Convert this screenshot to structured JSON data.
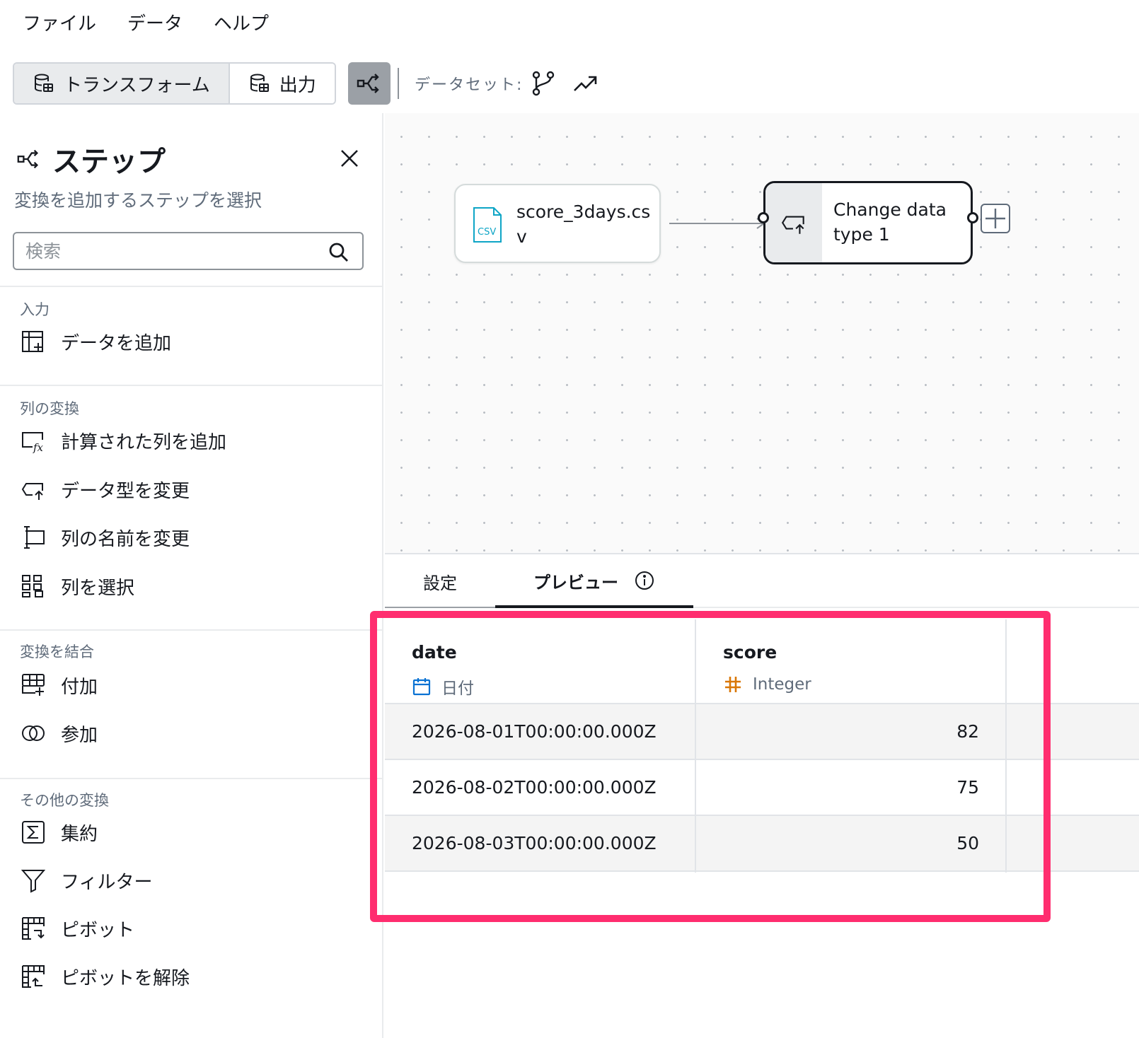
{
  "menu": {
    "file": "ファイル",
    "data": "データ",
    "help": "ヘルプ"
  },
  "toolbar": {
    "transform_label": "トランスフォーム",
    "output_label": "出力",
    "dataset_label": "データセット:",
    "icons": [
      "database-icon",
      "graph-icon",
      "branch-icon",
      "trend-icon"
    ]
  },
  "steps_panel": {
    "title": "ステップ",
    "subtitle": "変換を追加するステップを選択",
    "search_placeholder": "検索",
    "sections": [
      {
        "title": "入力",
        "items": [
          {
            "label": "データを追加",
            "icon": "add-data-icon"
          }
        ]
      },
      {
        "title": "列の変換",
        "items": [
          {
            "label": "計算された列を追加",
            "icon": "calculated-column-icon"
          },
          {
            "label": "データ型を変更",
            "icon": "change-type-icon"
          },
          {
            "label": "列の名前を変更",
            "icon": "rename-column-icon"
          },
          {
            "label": "列を選択",
            "icon": "select-columns-icon"
          }
        ]
      },
      {
        "title": "変換を結合",
        "items": [
          {
            "label": "付加",
            "icon": "append-icon"
          },
          {
            "label": "参加",
            "icon": "join-icon"
          }
        ]
      },
      {
        "title": "その他の変換",
        "items": [
          {
            "label": "集約",
            "icon": "aggregate-icon"
          },
          {
            "label": "フィルター",
            "icon": "filter-icon"
          },
          {
            "label": "ピボット",
            "icon": "pivot-icon"
          },
          {
            "label": "ピボットを解除",
            "icon": "unpivot-icon"
          }
        ]
      }
    ]
  },
  "canvas": {
    "source_node": {
      "label": "score_3days.csv",
      "badge": "CSV"
    },
    "transform_node": {
      "label": "Change data type 1"
    }
  },
  "bottom_panel": {
    "tabs": {
      "settings": "設定",
      "preview": "プレビュー"
    },
    "columns": [
      {
        "name": "date",
        "type": "日付",
        "type_icon": "calendar-icon"
      },
      {
        "name": "score",
        "type": "Integer",
        "type_icon": "hash-icon"
      }
    ],
    "rows": [
      {
        "date": "2026-08-01T00:00:00.000Z",
        "score": "82"
      },
      {
        "date": "2026-08-02T00:00:00.000Z",
        "score": "75"
      },
      {
        "date": "2026-08-03T00:00:00.000Z",
        "score": "50"
      }
    ]
  },
  "colors": {
    "highlight": "#ff2d6f",
    "calendar": "#0972d3",
    "hash": "#d97706",
    "csv": "#0ea5c6"
  }
}
